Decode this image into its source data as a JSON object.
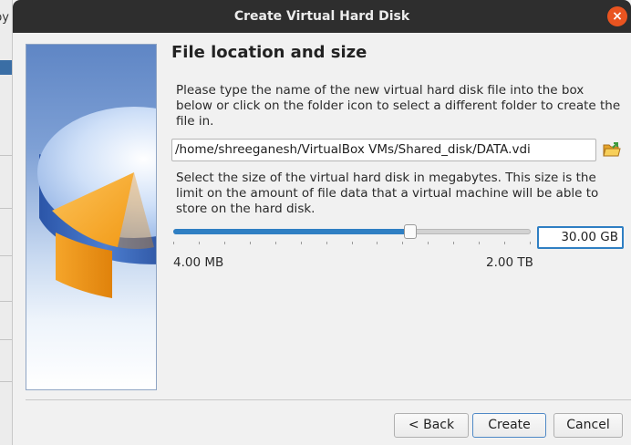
{
  "background_app": {
    "partial_label": "py"
  },
  "window": {
    "title": "Create Virtual Hard Disk",
    "close_glyph": "×"
  },
  "page": {
    "heading": "File location and size",
    "location_description": "Please type the name of the new virtual hard disk file into the box below or click on the folder icon to select a different folder to create the file in.",
    "file_path": "/home/shreeganesh/VirtualBox VMs/Shared_disk/DATA.vdi",
    "size_description": "Select the size of the virtual hard disk in megabytes. This size is the limit on the amount of file data that a virtual machine will be able to store on the hard disk.",
    "size_value": "30.00 GB",
    "slider_position": 0.67,
    "size_min_label": "4.00 MB",
    "size_max_label": "2.00 TB"
  },
  "buttons": {
    "back_label": "< Back",
    "create_label": "Create",
    "cancel_label": "Cancel"
  },
  "colors": {
    "accent": "#2f7fc3",
    "titlebar": "#2e2e2e",
    "close": "#e95420"
  },
  "icons": {
    "folder": "folder-open-icon",
    "close": "close-icon",
    "side": "hard-disk-pie-graphic"
  }
}
